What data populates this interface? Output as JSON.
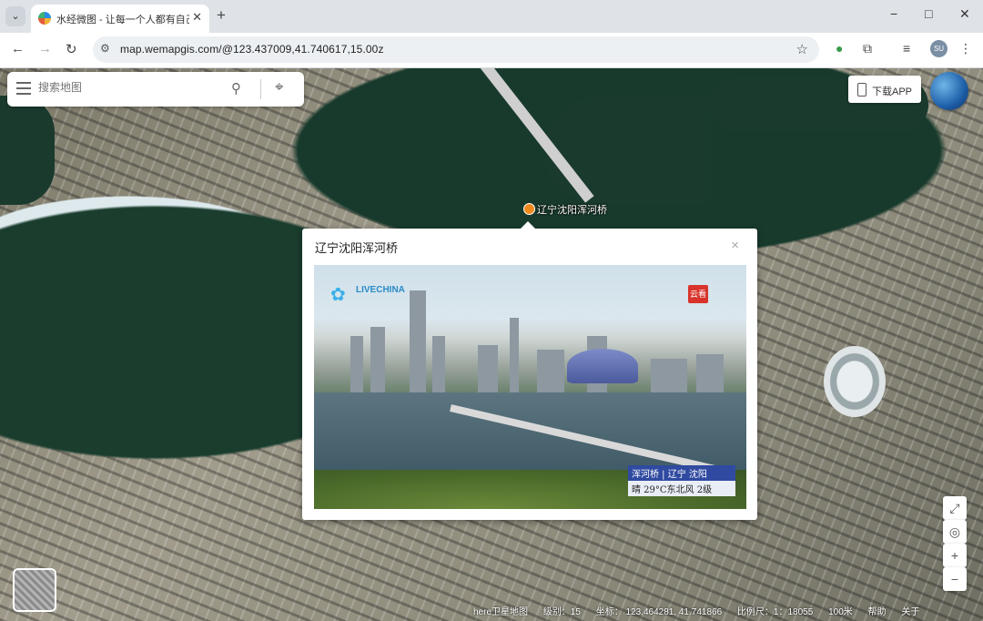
{
  "browser": {
    "tab": {
      "title": "水经微图 - 让每一个人都有自己的地图"
    },
    "new_tab": "+",
    "window_controls": {
      "minimize": "−",
      "maximize": "□",
      "close": "✕"
    },
    "url": "map.wemapgis.com/@123.437009,41.740617,15.00z",
    "profile_initials": "SU"
  },
  "map": {
    "search": {
      "placeholder": "搜索地图"
    },
    "download_label": "下载APP",
    "marker_label": "辽宁沈阳浑河桥",
    "popup": {
      "title": "辽宁沈阳浑河桥",
      "close": "×",
      "camera_logo_text": "LIVECHINA",
      "badge_text": "云看",
      "caption_line1": "浑河桥 | 辽宁 沈阳",
      "caption_line2": "晴 29°C东北风 2级"
    },
    "controls": {
      "zoom_in": "+",
      "zoom_out": "−"
    },
    "status": {
      "source": "here卫星地图",
      "zoom_label": "级别：15",
      "coords_label": "坐标： 123.464281, 41.741866",
      "scale_label": "比例尺：1：18055",
      "scale_bar": "100米",
      "help": "帮助",
      "about": "关于"
    }
  }
}
